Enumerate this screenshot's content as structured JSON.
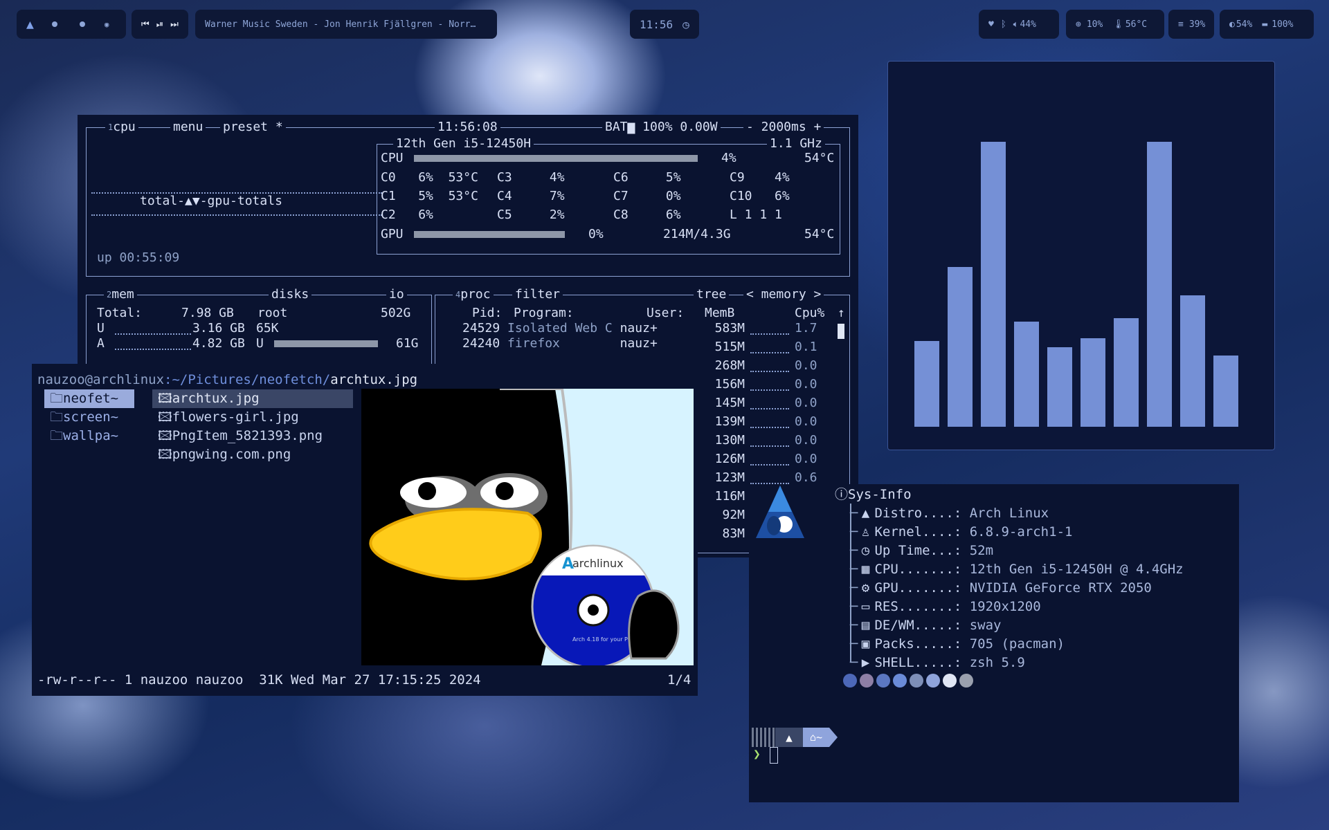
{
  "topbar": {
    "workspaces": [
      "",
      "",
      "",
      ""
    ],
    "media_controls": [
      "⏮",
      "⏯",
      "⏭"
    ],
    "now_playing": "Warner Music Sweden - Jon Henrik Fjällgren - Norr…",
    "clock": "11:56",
    "volume": "44%",
    "cpu": "10%",
    "temp": "56°C",
    "memory": "39%",
    "brightness": "54%",
    "battery": "100%"
  },
  "btop": {
    "cpu_box": {
      "tab_num": "1",
      "tab_cpu": "cpu",
      "tab_menu": "menu",
      "tab_preset": "preset *",
      "time": "11:56:08",
      "battery": "BAT▆ 100% 0.00W",
      "interval": "- 2000ms +",
      "model": "12th Gen i5-12450H",
      "freq": "1.1 GHz",
      "graph_label": "total-▲▼-gpu-totals",
      "uptime": "up 00:55:09",
      "cpu_pct": "4%",
      "cpu_temp": "54°C",
      "cores": [
        {
          "name": "C0",
          "val": "6%",
          "temp": "53°C"
        },
        {
          "name": "C1",
          "val": "5%",
          "temp": "53°C"
        },
        {
          "name": "C2",
          "val": "6%",
          "temp": ""
        },
        {
          "name": "C3",
          "val": "4%"
        },
        {
          "name": "C4",
          "val": "7%"
        },
        {
          "name": "C5",
          "val": "2%"
        },
        {
          "name": "C6",
          "val": "5%"
        },
        {
          "name": "C7",
          "val": "0%"
        },
        {
          "name": "C8",
          "val": "6%"
        },
        {
          "name": "C9",
          "val": "4%"
        },
        {
          "name": "C10",
          "val": "6%"
        }
      ],
      "load": "L 1 1 1",
      "gpu_label": "GPU",
      "gpu_pct": "0%",
      "gpu_mem": "214M/4.3G",
      "gpu_temp": "54°C"
    },
    "mem_box": {
      "num": "2",
      "title": "mem",
      "disks": "disks",
      "io": "io",
      "total_label": "Total:",
      "total": "7.98 GB",
      "used_label": "U",
      "used": "3.16 GB",
      "avail_label": "A",
      "avail": "4.82 GB",
      "root": "root",
      "root_size": "502G",
      "disk_used": "65K",
      "disk_u": "U",
      "disk_u_size": "61G"
    },
    "proc_box": {
      "num": "4",
      "title": "proc",
      "filter": "filter",
      "tree": "tree",
      "sort": "< memory >",
      "headers": {
        "pid": "Pid:",
        "program": "Program:",
        "user": "User:",
        "memb": "MemB",
        "cpu": "Cpu%"
      },
      "rows": [
        {
          "pid": "24529",
          "program": "Isolated Web C",
          "user": "nauz+",
          "mem": "583M",
          "cpu": "1.7"
        },
        {
          "pid": "24240",
          "program": "firefox",
          "user": "nauz+",
          "mem": "515M",
          "cpu": "0.1"
        },
        {
          "mem": "268M",
          "cpu": "0.0"
        },
        {
          "mem": "156M",
          "cpu": "0.0"
        },
        {
          "mem": "145M",
          "cpu": "0.0"
        },
        {
          "mem": "139M",
          "cpu": "0.0"
        },
        {
          "mem": "130M",
          "cpu": "0.0"
        },
        {
          "mem": "126M",
          "cpu": "0.0"
        },
        {
          "mem": "123M",
          "cpu": "0.6"
        },
        {
          "mem": "116M",
          "cpu": ""
        },
        {
          "mem": "92M",
          "cpu": ""
        },
        {
          "mem": "83M",
          "cpu": ""
        }
      ]
    }
  },
  "ranger": {
    "user_host": "nauzoo@archlinux",
    "path": ":~/Pictures/neofetch/",
    "file": "archtux.jpg",
    "dirs": [
      "neofet~",
      "screen~",
      "wallpa~"
    ],
    "files": [
      "archtux.jpg",
      "flowers-girl.jpg",
      "PngItem_5821393.png",
      "pngwing.com.png"
    ],
    "status": "-rw-r--r-- 1 nauzoo nauzoo  31K Wed Mar 27 17:15:25 2024",
    "position": "1/4",
    "preview_text": "archlinux",
    "disc_text": "Arch 4.18\nfor your PC"
  },
  "cava": {
    "levels": [
      0.3,
      0.56,
      1.0,
      0.37,
      0.28,
      0.31,
      0.38,
      1.0,
      0.46,
      0.25
    ]
  },
  "sysinfo": {
    "title": "Sys-Info",
    "rows": [
      {
        "icon": "arch-icon",
        "label": "Distro....:",
        "value": "Arch Linux"
      },
      {
        "icon": "tux-icon",
        "label": "Kernel....:",
        "value": "6.8.9-arch1-1"
      },
      {
        "icon": "clock-icon",
        "label": "Up Time...:",
        "value": "52m"
      },
      {
        "icon": "chip-icon",
        "label": "CPU.......:",
        "value": "12th Gen i5-12450H @ 4.4GHz"
      },
      {
        "icon": "gear-icon",
        "label": "GPU.......:",
        "value": "NVIDIA GeForce RTX 2050"
      },
      {
        "icon": "monitor-icon",
        "label": "RES.......:",
        "value": "1920x1200"
      },
      {
        "icon": "window-icon",
        "label": "DE/WM.....:",
        "value": "sway"
      },
      {
        "icon": "package-icon",
        "label": "Packs.....:",
        "value": "705 (pacman)"
      },
      {
        "icon": "terminal-icon",
        "label": "SHELL.....:",
        "value": "zsh 5.9"
      }
    ],
    "palette": [
      "#4d68b8",
      "#8e7fa6",
      "#5b77c2",
      "#6a8bd8",
      "#7e8fb8",
      "#8fa4dc",
      "#e0e6f4",
      "#9aa0ae"
    ],
    "prompt_dir": "~",
    "prompt_symbol": "❯"
  }
}
